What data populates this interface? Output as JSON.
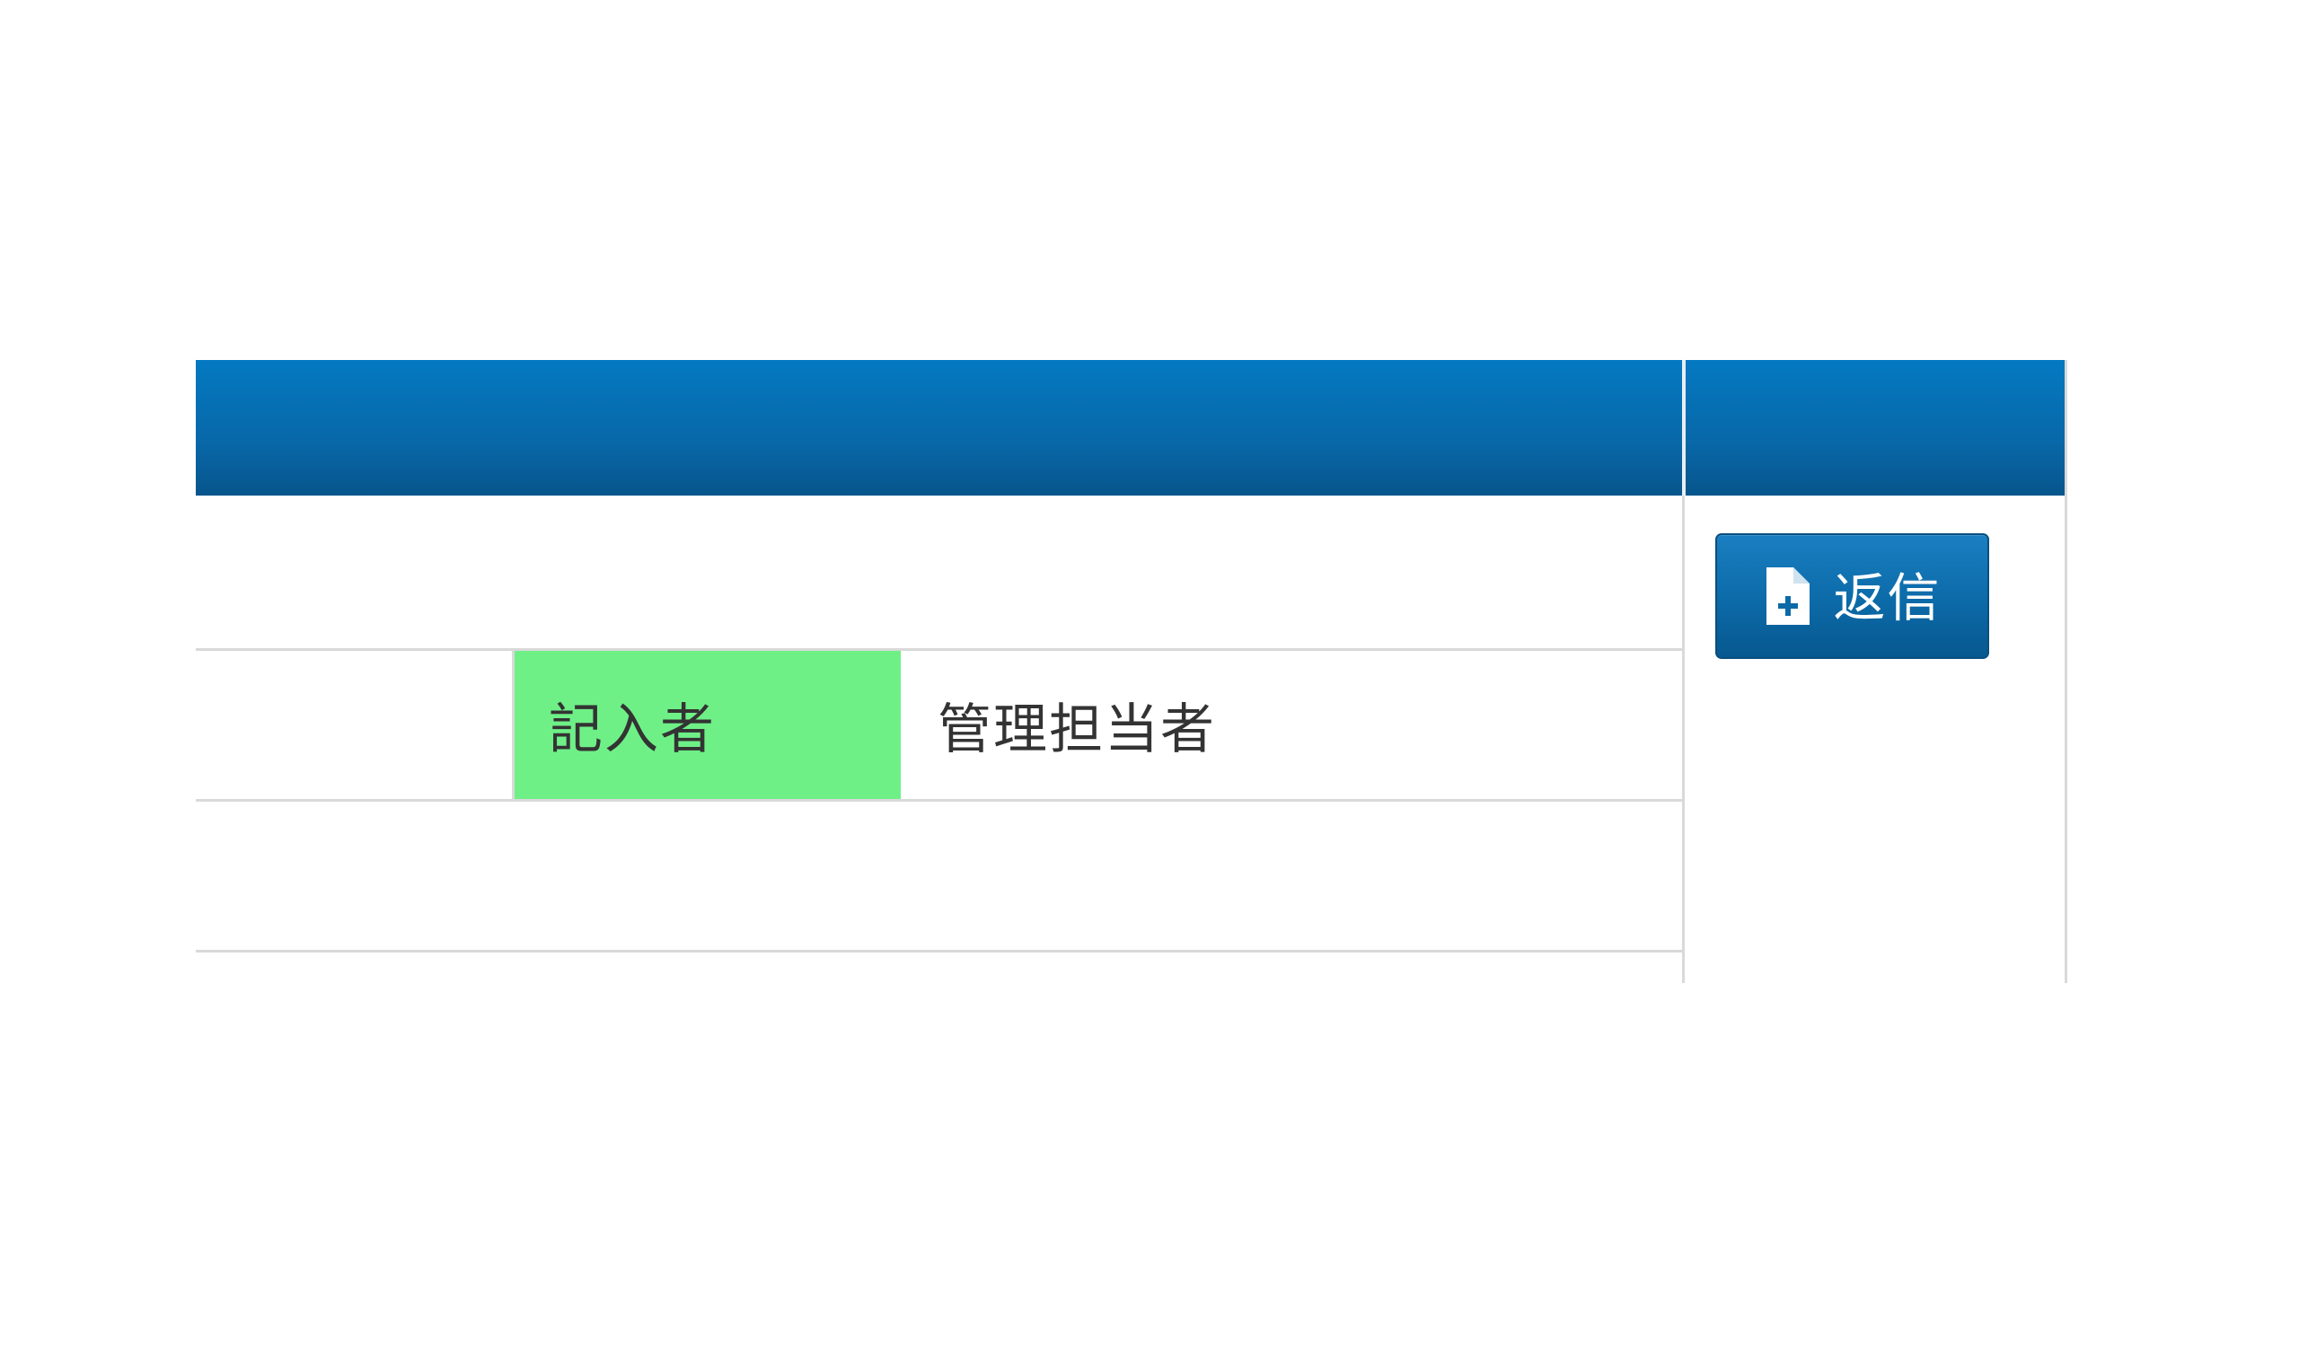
{
  "table": {
    "rows": [
      {
        "label": "記入者",
        "value": "管理担当者"
      }
    ]
  },
  "reply_button": {
    "label": "返信",
    "icon": "file-plus-icon"
  },
  "colors": {
    "header_bar": "#0868a8",
    "label_cell": "#6ef087",
    "button": "#0c6aa8"
  }
}
